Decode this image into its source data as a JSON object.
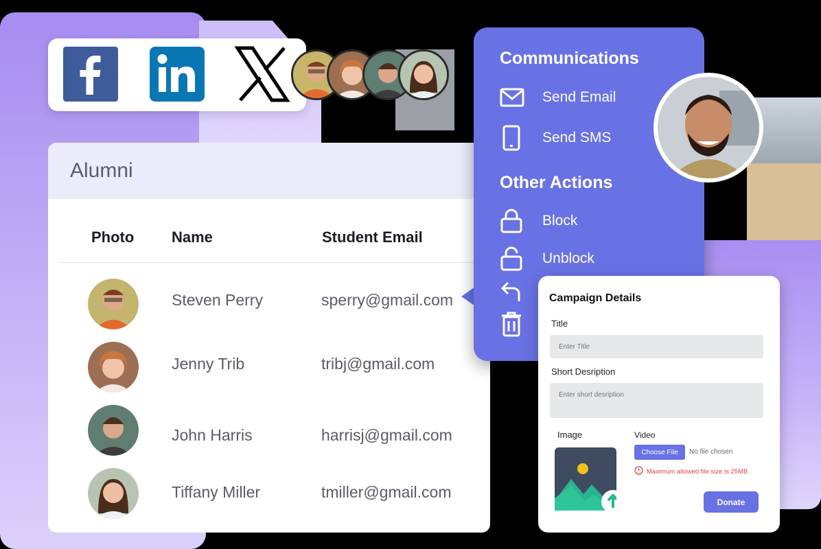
{
  "social": {
    "icons": [
      "facebook-icon",
      "linkedin-icon",
      "x-icon"
    ],
    "avatars": [
      "avatar-steven",
      "avatar-jenny",
      "avatar-john",
      "avatar-tiffany"
    ]
  },
  "alumni": {
    "title": "Alumni",
    "columns": [
      "Photo",
      "Name",
      "Student Email"
    ],
    "rows": [
      {
        "name": "Steven Perry",
        "email": "sperry@gmail.com"
      },
      {
        "name": "Jenny Trib",
        "email": "tribj@gmail.com"
      },
      {
        "name": "John Harris",
        "email": "harrisj@gmail.com"
      },
      {
        "name": "Tiffany Miller",
        "email": "tmiller@gmail.com"
      }
    ]
  },
  "menu": {
    "communications_heading": "Communications",
    "send_email": "Send Email",
    "send_sms": "Send SMS",
    "other_heading": "Other Actions",
    "block": "Block",
    "unblock": "Unblock"
  },
  "campaign": {
    "heading": "Campaign Details",
    "title_label": "Title",
    "title_placeholder": "Enter Title",
    "desc_label": "Short Desription",
    "desc_placeholder": "Enter short desription",
    "image_label": "Image",
    "video_label": "Video",
    "choose_file": "Choose File",
    "no_file": "No file chosen",
    "error": "Maximum allowed file size is 25MB",
    "donate": "Donate"
  },
  "colors": {
    "accent": "#6872e4",
    "facebook": "#3f5c9a",
    "linkedin": "#0a77b5",
    "error": "#e24040",
    "header_bg": "#eaecf9"
  }
}
